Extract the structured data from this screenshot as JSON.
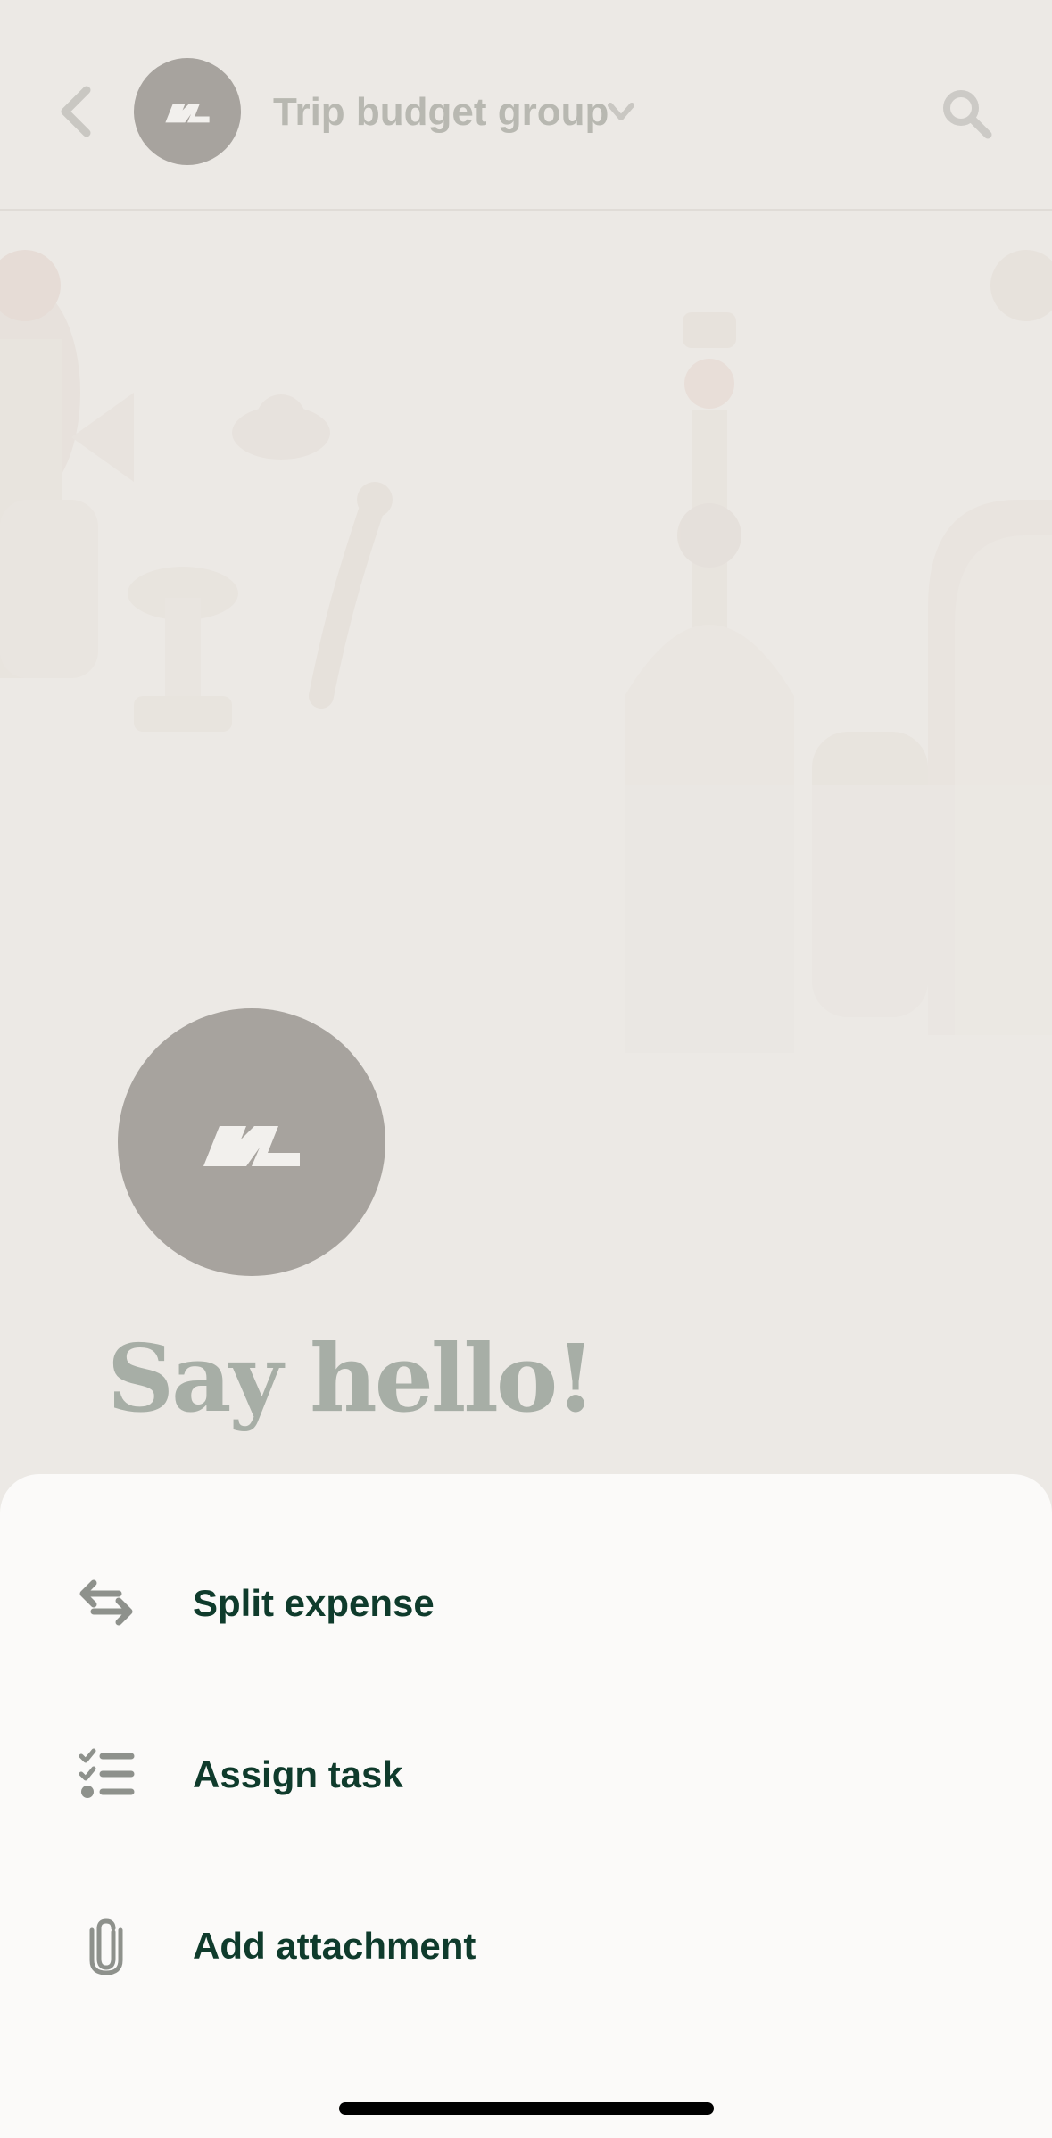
{
  "header": {
    "back_icon": "chevron-left-icon",
    "group_avatar_icon": "group-logo-icon",
    "title": "Trip budget group",
    "title_dropdown_icon": "chevron-down-icon",
    "search_icon": "search-icon"
  },
  "intro": {
    "avatar_icon": "group-logo-icon",
    "greeting": "Say hello!"
  },
  "sheet": {
    "items": [
      {
        "label": "Split expense",
        "icon": "split-arrows-icon"
      },
      {
        "label": "Assign task",
        "icon": "checklist-icon"
      },
      {
        "label": "Add attachment",
        "icon": "paperclip-icon"
      }
    ]
  },
  "colors": {
    "background": "#ECE9E5",
    "sheet_background": "#FBFAF9",
    "primary_text": "#0F3B2C",
    "dimmed_text": "#B8B8B1",
    "avatar": "#A7A39E",
    "icon_gray": "#8E918C"
  }
}
